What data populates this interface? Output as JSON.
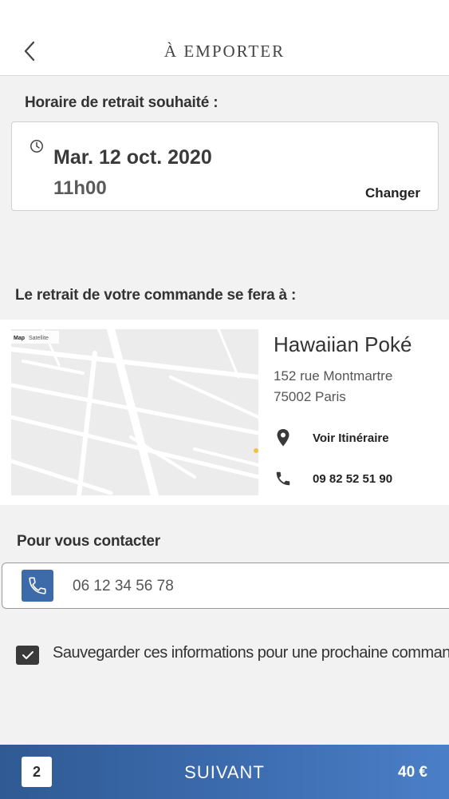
{
  "header": {
    "title": "À EMPORTER"
  },
  "pickup_time": {
    "label": "Horaire de retrait souhaité :",
    "date": "Mar. 12 oct. 2020",
    "hour": "11h00",
    "change_label": "Changer"
  },
  "pickup_location": {
    "label": "Le retrait de votre commande se fera à :",
    "store_name": "Hawaiian Poké",
    "address_line1": "152 rue Montmartre",
    "address_line2": "75002 Paris",
    "directions_label": "Voir Itinéraire",
    "phone": "09 82 52 51 90"
  },
  "map": {
    "type_map": "Map",
    "type_satellite": "Satellite"
  },
  "contact": {
    "label": "Pour vous contacter",
    "phone_value": "06 12 34 56 78"
  },
  "save_option": {
    "checked": true,
    "label": "Sauvegarder ces informations pour une prochaine commande"
  },
  "footer": {
    "item_count": "2",
    "next_label": "SUIVANT",
    "total": "40 €"
  },
  "colors": {
    "accent": "#3d6aa8",
    "footer_gradient_start": "#2f5a93",
    "footer_gradient_end": "#4a7fc7"
  },
  "icons": {
    "back": "chevron-left-icon",
    "clock": "clock-icon",
    "location": "map-pin-icon",
    "phone": "phone-icon",
    "check": "check-icon"
  }
}
